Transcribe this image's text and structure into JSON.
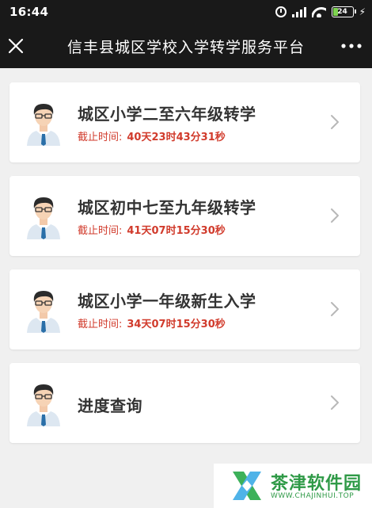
{
  "status_bar": {
    "time": "16:44",
    "battery": "24",
    "battery_level": 0.24
  },
  "header": {
    "title": "信丰县城区学校入学转学服务平台"
  },
  "deadline_label": "截止时间:",
  "items": [
    {
      "title": "城区小学二至六年级转学",
      "countdown": "40天23时43分31秒"
    },
    {
      "title": "城区初中七至九年级转学",
      "countdown": "41天07时15分30秒"
    },
    {
      "title": "城区小学一年级新生入学",
      "countdown": "34天07时15分30秒"
    },
    {
      "title": "进度查询"
    }
  ],
  "watermark": {
    "text": "茶津软件园",
    "url": "WWW.CHAJINHUI.TOP"
  },
  "colors": {
    "header_bg": "#191919",
    "deadline": "#d13b2c",
    "page_bg": "#f0f0f0"
  }
}
